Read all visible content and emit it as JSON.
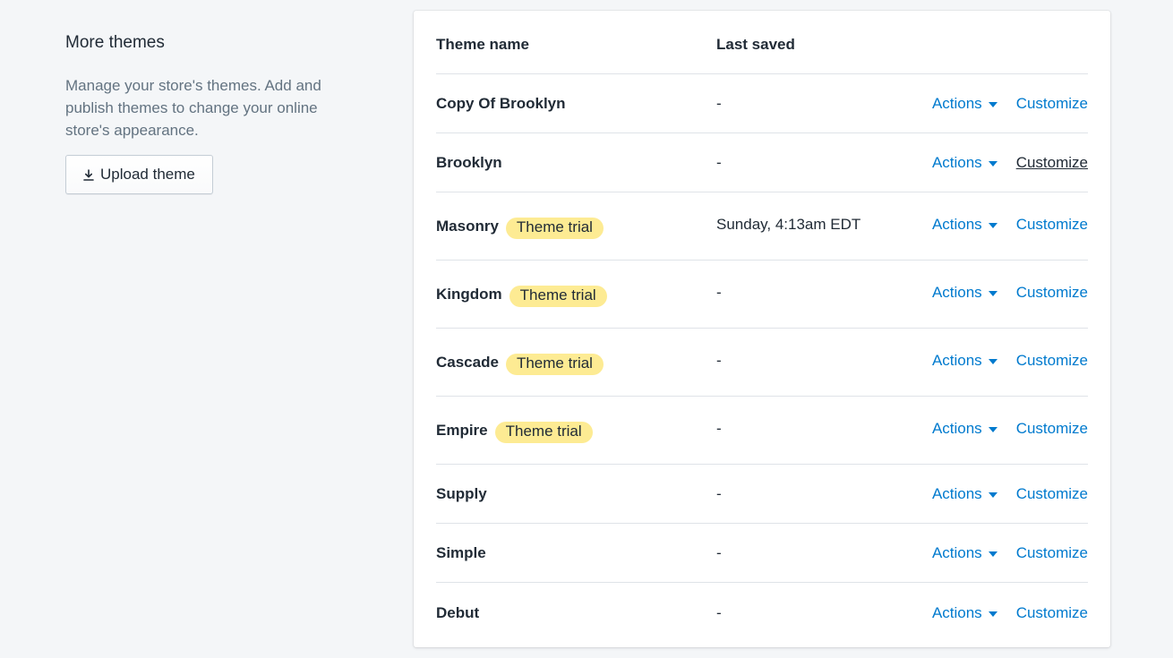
{
  "annotation": {
    "title": "More themes",
    "description": "Manage your store's themes. Add and publish themes to change your online store's appearance.",
    "upload_button": "Upload theme"
  },
  "table": {
    "headers": {
      "name": "Theme name",
      "last_saved": "Last saved"
    },
    "actions_label": "Actions",
    "customize_label": "Customize",
    "badge_label": "Theme trial",
    "rows": [
      {
        "name": "Copy Of Brooklyn",
        "last_saved": "-",
        "trial": false
      },
      {
        "name": "Brooklyn",
        "last_saved": "-",
        "trial": false
      },
      {
        "name": "Masonry",
        "last_saved": "Sunday, 4:13am EDT",
        "trial": true
      },
      {
        "name": "Kingdom",
        "last_saved": "-",
        "trial": true
      },
      {
        "name": "Cascade",
        "last_saved": "-",
        "trial": true
      },
      {
        "name": "Empire",
        "last_saved": "-",
        "trial": true
      },
      {
        "name": "Supply",
        "last_saved": "-",
        "trial": false
      },
      {
        "name": "Simple",
        "last_saved": "-",
        "trial": false
      },
      {
        "name": "Debut",
        "last_saved": "-",
        "trial": false
      }
    ]
  },
  "colors": {
    "link": "#007ace",
    "badge": "#fdeb93",
    "text": "#212b36",
    "subdued": "#637381",
    "background": "#f4f6f8"
  },
  "icons": {
    "upload": "download-arrow-icon",
    "actions": "caret-down-icon"
  }
}
